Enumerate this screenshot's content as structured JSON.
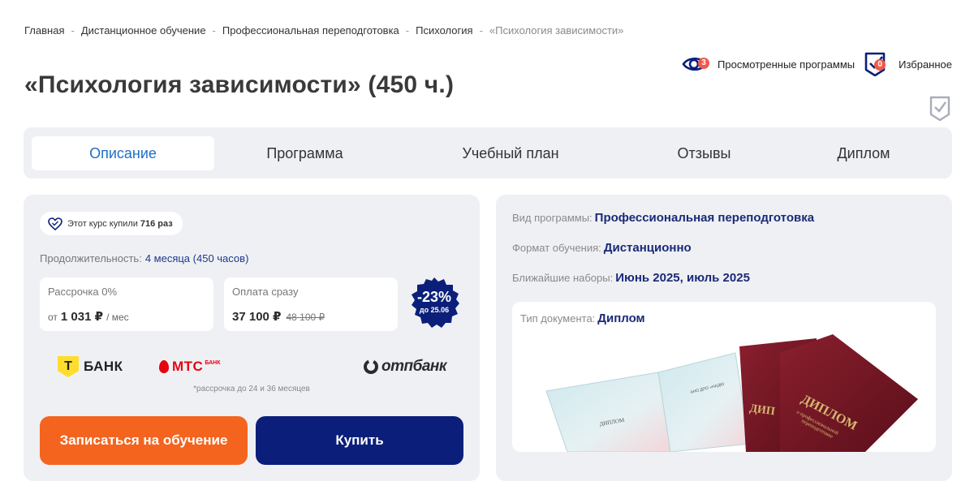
{
  "breadcrumb": [
    "Главная",
    "Дистанционное обучение",
    "Профессиональная переподготовка",
    "Психология",
    "«Психология зависимости»"
  ],
  "breadcrumb_sep": "-",
  "header": {
    "viewed_label": "Просмотренные программы",
    "viewed_count": "3",
    "favorites_label": "Избранное",
    "favorites_count": "0"
  },
  "title": "«Психология зависимости» (450 ч.)",
  "tabs": [
    "Описание",
    "Программа",
    "Учебный план",
    "Отзывы",
    "Диплом"
  ],
  "active_tab": "Описание",
  "purchase": {
    "bought_prefix": "Этот курс купили",
    "bought_count": "716 раз",
    "duration_label": "Продолжительность:",
    "duration_value": "4 месяца (450 часов)",
    "installment_label": "Рассрочка 0%",
    "installment_from": "от",
    "installment_amount": "1 031 ₽",
    "installment_period": "/ мес",
    "full_label": "Оплата сразу",
    "full_price": "37 100 ₽",
    "old_price": "48 100 ₽",
    "discount_pct": "-23%",
    "discount_until": "до 25.06",
    "banks": {
      "tbank_letter": "Т",
      "tbank": "БАНК",
      "mts": "МТС",
      "mts_sub": "БАНК",
      "otp": "отпбанк"
    },
    "installment_note": "*рассрочка до 24 и 36 месяцев",
    "enroll_button": "Записаться на обучение",
    "buy_button": "Купить"
  },
  "program_info": {
    "type_label": "Вид программы:",
    "type_value": "Профессиональная переподготовка",
    "format_label": "Формат обучения:",
    "format_value": "Дистанционно",
    "next_label": "Ближайшие наборы:",
    "next_value": "Июнь 2025, июль 2025",
    "doc_label": "Тип документа:",
    "doc_value": "Диплом",
    "diploma_cover_title": "ДИПЛОМ",
    "diploma_cover_sub1": "о профессиональной",
    "diploma_cover_sub2": "переподготовке",
    "diploma_back_title": "ДИП",
    "diploma_page_title": "ДИПЛОМ",
    "diploma_page_org": "АНО ДПО «НАДЮ"
  },
  "colors": {
    "accent_blue": "#1f6fc4",
    "navy": "#0b1f7a",
    "orange": "#f4641e",
    "badge_red": "#f05a4a",
    "panel_bg": "#eff0f4"
  }
}
